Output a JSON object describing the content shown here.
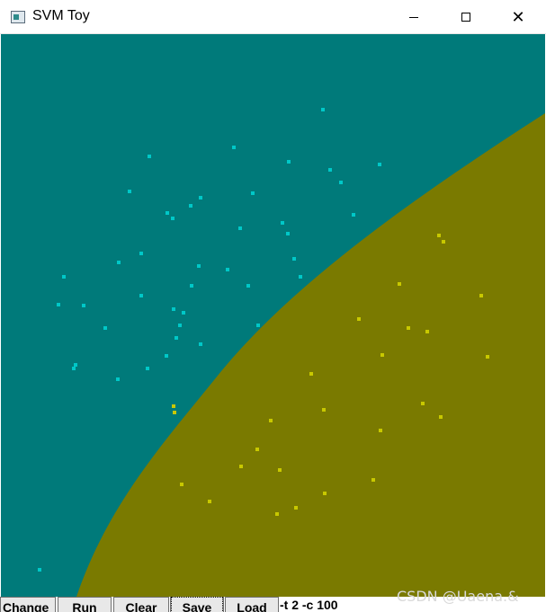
{
  "window": {
    "title": "SVM Toy"
  },
  "colors": {
    "class_a_region": "#007a7a",
    "class_b_region": "#7a7a00",
    "class_a_point": "#00c8c8",
    "class_b_point": "#c8c800"
  },
  "toolbar": {
    "change_label": "Change",
    "run_label": "Run",
    "clear_label": "Clear",
    "save_label": "Save",
    "load_label": "Load",
    "params_value": "-t 2 -c 100"
  },
  "watermark": "CSDN @Uaena.&"
}
